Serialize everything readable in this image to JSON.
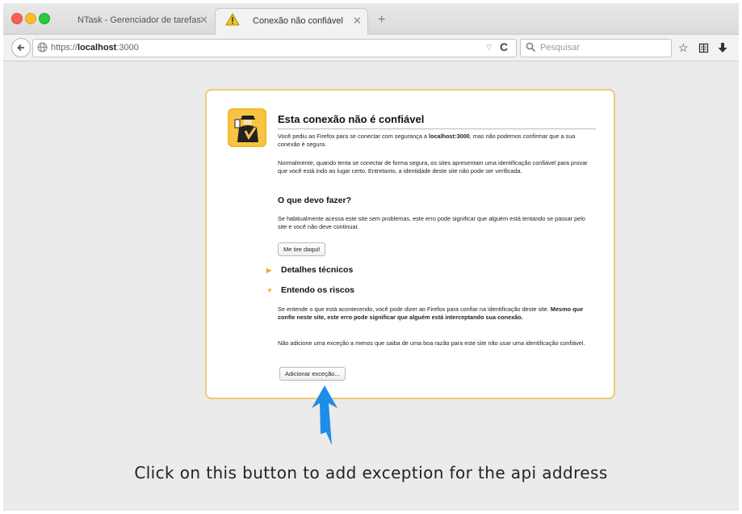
{
  "tabs": [
    {
      "title": "NTask - Gerenciador de tarefas",
      "close": "✕"
    },
    {
      "title": "Conexão não confiável",
      "close": "✕"
    }
  ],
  "new_tab": "+",
  "address": {
    "prefix": "https://",
    "host": "localhost",
    "port": ":3000"
  },
  "search": {
    "placeholder": "Pesquisar"
  },
  "icons": {
    "back": "back-arrow-icon",
    "globe": "globe-icon",
    "dropdown": "dropdown-arrow-icon",
    "reload": "reload-icon",
    "search": "magnifier-icon",
    "bookmark": "star-icon",
    "reading_list": "reading-list-icon",
    "downloads": "download-arrow-icon",
    "warning": "warning-triangle-icon",
    "guard": "security-guard-icon"
  },
  "colors": {
    "card_border": "#f0c976",
    "accent_arrow": "#1e8de8",
    "expander_arrow": "#f0a830"
  },
  "warning_page": {
    "title": "Esta conexão não é confiável",
    "p1_a": "Você pediu ao Firefox para se conectar  com segurança a ",
    "p1_host": "localhost:3000",
    "p1_b": ", mas não podemos confirmar que a sua conexão é segura.",
    "p2": "Normalmente, quando tenta se conectar de forma segura, os sites apresentam uma identificação confiável para provar que você está  indo ao lugar certo. Entretanto, a identidade deste site não pode ser verificada.",
    "h2": "O que devo fazer?",
    "p3": "Se habitualmente acessa  este site sem problemas, este erro pode significar que alguém está tentando se passar pelo site e você não deve continuar.",
    "btn_leave": "Me tire daqui!",
    "tech_details": "Detalhes técnicos",
    "understand_risks": "Entendo os riscos",
    "p4_a": "Se entende o que está acontecendo, você  pode dizer ao Firefox para confiar na identificação deste site.  ",
    "p4_b": "Mesmo que confie neste site, este erro pode significar que alguém está interceptando sua conexão.",
    "p5": "Não adicione uma exceção a menos  que saiba de uma boa razão para este site não usar uma identificação confiável.",
    "btn_add_exception": "Adicionar exceção..."
  },
  "caption": "Click on this button to add exception for the api address"
}
